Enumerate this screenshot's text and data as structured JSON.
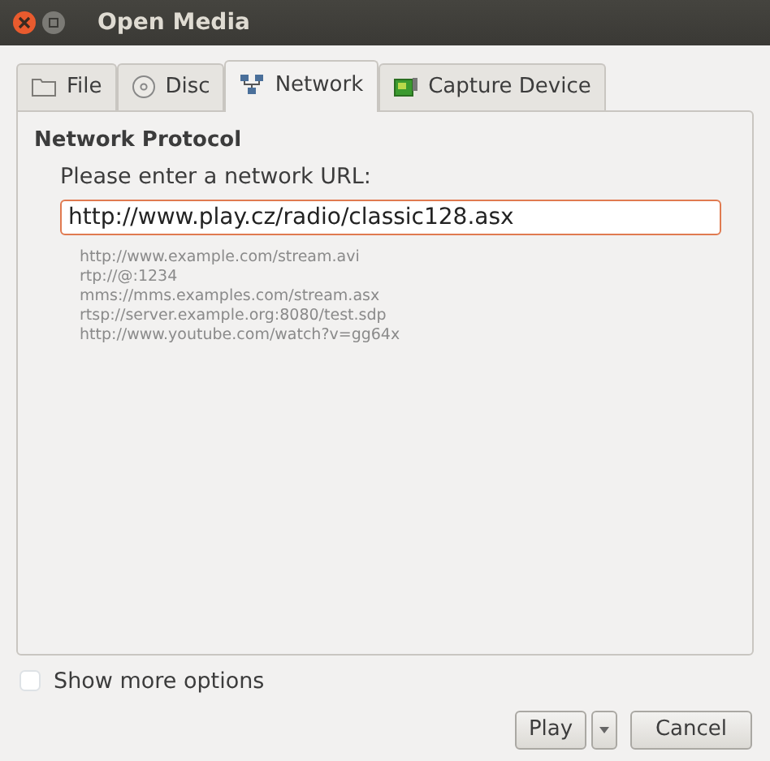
{
  "window": {
    "title": "Open Media"
  },
  "tabs": [
    {
      "label": "File",
      "kind": "folder",
      "selected": false
    },
    {
      "label": "Disc",
      "kind": "disc",
      "selected": false
    },
    {
      "label": "Network",
      "kind": "network",
      "selected": true
    },
    {
      "label": "Capture Device",
      "kind": "capture",
      "selected": false
    }
  ],
  "section": {
    "heading": "Network Protocol",
    "prompt": "Please enter a network URL:",
    "url": "http://www.play.cz/radio/classic128.asx",
    "examples": [
      "http://www.example.com/stream.avi",
      "rtp://@:1234",
      "mms://mms.examples.com/stream.asx",
      "rtsp://server.example.org:8080/test.sdp",
      "http://www.youtube.com/watch?v=gg64x"
    ]
  },
  "show_more_options": {
    "label": "Show more options",
    "checked": false
  },
  "buttons": {
    "play": "Play",
    "cancel": "Cancel"
  }
}
